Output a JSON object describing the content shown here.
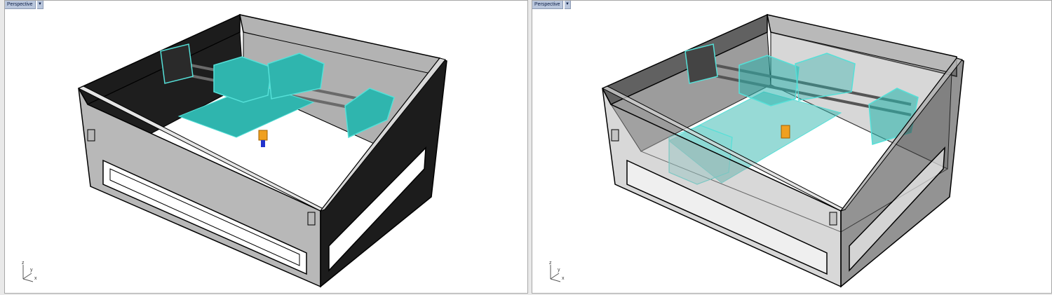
{
  "viewports": [
    {
      "label": "Perspective",
      "mode": "shaded",
      "menu_icon": "dropdown-arrow-icon"
    },
    {
      "label": "Perspective",
      "mode": "ghosted",
      "menu_icon": "dropdown-arrow-icon"
    }
  ],
  "axis_labels": {
    "z": "z",
    "y": "y",
    "x": "x"
  },
  "colors": {
    "cyan_part": "#2fb5ae",
    "cyan_edge": "#55e0d8",
    "panel_gray": "#b8b8b8",
    "panel_dark": "#1c1c1c",
    "nozzle_orange": "#f0a020",
    "nozzle_blue": "#2233cc",
    "label_bg": "#b9c6dc"
  }
}
